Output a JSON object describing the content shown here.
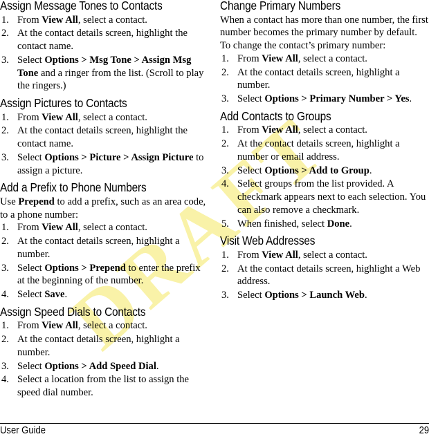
{
  "watermark": {
    "text": "DRAFT",
    "color": "#f9f2a8"
  },
  "footer": {
    "label": "User Guide",
    "page_number": "29"
  },
  "columns": {
    "left": [
      {
        "heading": "Assign Message Tones to Contacts",
        "steps": [
          {
            "num": "1.",
            "parts": [
              {
                "t": "From "
              },
              {
                "t": "View All",
                "b": true
              },
              {
                "t": ", select a contact."
              }
            ]
          },
          {
            "num": "2.",
            "parts": [
              {
                "t": "At the contact details screen, highlight the contact name."
              }
            ]
          },
          {
            "num": "3.",
            "parts": [
              {
                "t": "Select "
              },
              {
                "t": "Options > Msg Tone > Assign Msg Tone",
                "b": true
              },
              {
                "t": " and a ringer from the list. (Scroll to play the ringers.)"
              }
            ]
          }
        ]
      },
      {
        "heading": "Assign Pictures to Contacts",
        "steps": [
          {
            "num": "1.",
            "parts": [
              {
                "t": "From "
              },
              {
                "t": "View All",
                "b": true
              },
              {
                "t": ", select a contact."
              }
            ]
          },
          {
            "num": "2.",
            "parts": [
              {
                "t": "At the contact details screen, highlight the contact name."
              }
            ]
          },
          {
            "num": "3.",
            "parts": [
              {
                "t": "Select "
              },
              {
                "t": "Options > Picture > Assign Picture",
                "b": true
              },
              {
                "t": " to assign a picture."
              }
            ]
          }
        ]
      },
      {
        "heading": "Add a Prefix to Phone Numbers",
        "intro_parts": [
          {
            "t": "Use "
          },
          {
            "t": "Prepend",
            "b": true
          },
          {
            "t": " to add a prefix, such as an area code, to a phone number:"
          }
        ],
        "steps": [
          {
            "num": "1.",
            "parts": [
              {
                "t": "From "
              },
              {
                "t": "View All",
                "b": true
              },
              {
                "t": ", select a contact."
              }
            ]
          },
          {
            "num": "2.",
            "parts": [
              {
                "t": "At the contact details screen, highlight a number."
              }
            ]
          },
          {
            "num": "3.",
            "parts": [
              {
                "t": "Select "
              },
              {
                "t": "Options > Prepend",
                "b": true
              },
              {
                "t": " to enter the prefix at the beginning of the number."
              }
            ]
          },
          {
            "num": "4.",
            "parts": [
              {
                "t": "Select "
              },
              {
                "t": "Save",
                "b": true
              },
              {
                "t": "."
              }
            ]
          }
        ]
      },
      {
        "heading": "Assign Speed Dials to Contacts",
        "steps": [
          {
            "num": "1.",
            "parts": [
              {
                "t": "From "
              },
              {
                "t": "View All",
                "b": true
              },
              {
                "t": ", select a contact."
              }
            ]
          },
          {
            "num": "2.",
            "parts": [
              {
                "t": "At the contact details screen, highlight a number."
              }
            ]
          },
          {
            "num": "3.",
            "parts": [
              {
                "t": "Select "
              },
              {
                "t": "Options > Add Speed Dial",
                "b": true
              },
              {
                "t": "."
              }
            ]
          },
          {
            "num": "4.",
            "parts": [
              {
                "t": "Select a location from the list to assign the speed dial number."
              }
            ]
          }
        ]
      }
    ],
    "right": [
      {
        "heading": "Change Primary Numbers",
        "intro_parts": [
          {
            "t": "When a contact has more than one number, the first number becomes the primary number by default. To change the contact’s primary number:"
          }
        ],
        "steps": [
          {
            "num": "1.",
            "parts": [
              {
                "t": "From "
              },
              {
                "t": "View All",
                "b": true
              },
              {
                "t": ", select a contact."
              }
            ]
          },
          {
            "num": "2.",
            "parts": [
              {
                "t": "At the contact details screen, highlight a number."
              }
            ]
          },
          {
            "num": "3.",
            "parts": [
              {
                "t": "Select "
              },
              {
                "t": "Options > Primary Number > Yes",
                "b": true
              },
              {
                "t": "."
              }
            ]
          }
        ]
      },
      {
        "heading": "Add Contacts to Groups",
        "steps": [
          {
            "num": "1.",
            "parts": [
              {
                "t": "From "
              },
              {
                "t": "View All",
                "b": true
              },
              {
                "t": ", select a contact."
              }
            ]
          },
          {
            "num": "2.",
            "parts": [
              {
                "t": "At the contact details screen, highlight a number or email address."
              }
            ]
          },
          {
            "num": "3.",
            "parts": [
              {
                "t": "Select "
              },
              {
                "t": "Options > Add to Group",
                "b": true
              },
              {
                "t": "."
              }
            ]
          },
          {
            "num": "4.",
            "parts": [
              {
                "t": "Select groups from the list provided. A checkmark appears next to each selection. You can also remove a checkmark."
              }
            ]
          },
          {
            "num": "5.",
            "parts": [
              {
                "t": "When finished, select "
              },
              {
                "t": "Done",
                "b": true
              },
              {
                "t": "."
              }
            ]
          }
        ]
      },
      {
        "heading": "Visit Web Addresses",
        "steps": [
          {
            "num": "1.",
            "parts": [
              {
                "t": "From "
              },
              {
                "t": "View All",
                "b": true
              },
              {
                "t": ", select a contact."
              }
            ]
          },
          {
            "num": "2.",
            "parts": [
              {
                "t": "At the contact details screen, highlight a Web address."
              }
            ]
          },
          {
            "num": "3.",
            "parts": [
              {
                "t": "Select "
              },
              {
                "t": "Options > Launch Web",
                "b": true
              },
              {
                "t": "."
              }
            ]
          }
        ]
      }
    ]
  }
}
